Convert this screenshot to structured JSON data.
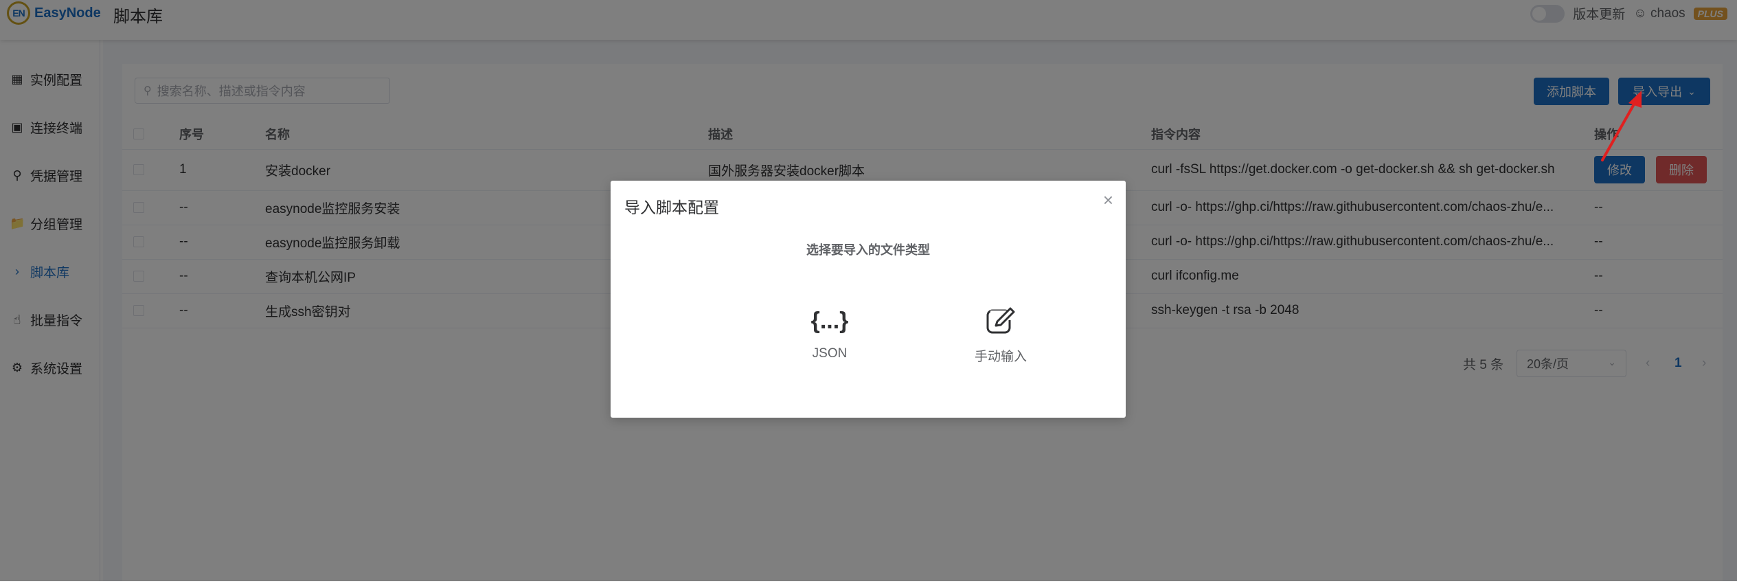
{
  "header": {
    "logo_mark": "EN",
    "logo_text": "EasyNode",
    "page_title": "脚本库",
    "version_update": "版本更新",
    "username": "chaos",
    "plus_badge": "PLUS"
  },
  "sidebar": {
    "items": [
      {
        "label": "实例配置",
        "icon": "grid-icon"
      },
      {
        "label": "连接终端",
        "icon": "terminal-icon"
      },
      {
        "label": "凭据管理",
        "icon": "key-icon"
      },
      {
        "label": "分组管理",
        "icon": "folder-icon"
      },
      {
        "label": "脚本库",
        "icon": "chevron-right-icon"
      },
      {
        "label": "批量指令",
        "icon": "hand-icon"
      },
      {
        "label": "系统设置",
        "icon": "gear-icon"
      }
    ],
    "active_index": 4
  },
  "toolbar": {
    "search_placeholder": "搜索名称、描述或指令内容",
    "add_button": "添加脚本",
    "import_export_button": "导入导出"
  },
  "table": {
    "headers": {
      "index": "序号",
      "name": "名称",
      "desc": "描述",
      "command": "指令内容",
      "ops": "操作"
    },
    "rows": [
      {
        "index": "1",
        "name": "安装docker",
        "desc": "国外服务器安装docker脚本",
        "command": "curl -fsSL https://get.docker.com -o get-docker.sh && sh get-docker.sh",
        "ops": ""
      },
      {
        "index": "--",
        "name": "easynode监控服务安装",
        "desc": "",
        "command": "curl -o- https://ghp.ci/https://raw.githubusercontent.com/chaos-zhu/e...",
        "ops": "--"
      },
      {
        "index": "--",
        "name": "easynode监控服务卸载",
        "desc": "",
        "command": "curl -o- https://ghp.ci/https://raw.githubusercontent.com/chaos-zhu/e...",
        "ops": "--"
      },
      {
        "index": "--",
        "name": "查询本机公网IP",
        "desc": "",
        "command": "curl ifconfig.me",
        "ops": "--"
      },
      {
        "index": "--",
        "name": "生成ssh密钥对",
        "desc": "",
        "command": "ssh-keygen -t rsa -b 2048",
        "ops": "--"
      }
    ],
    "edit_button": "修改",
    "delete_button": "删除"
  },
  "pagination": {
    "total_text": "共 5 条",
    "page_size": "20条/页",
    "current_page": "1"
  },
  "dialog": {
    "title": "导入脚本配置",
    "subtitle": "选择要导入的文件类型",
    "option_json": "JSON",
    "option_json_icon_text": "{...}",
    "option_manual": "手动输入"
  },
  "colors": {
    "primary": "#1d6fc4",
    "danger": "#e05555",
    "annotation_arrow": "#e02020"
  }
}
